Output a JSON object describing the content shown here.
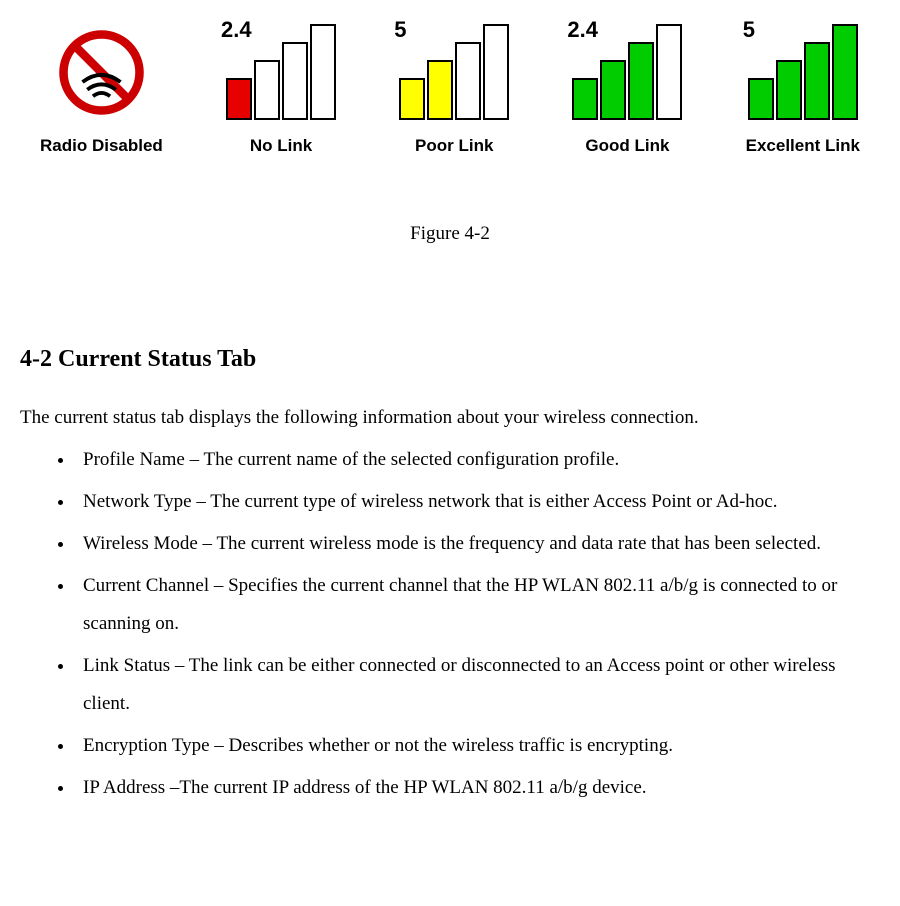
{
  "icons": {
    "disabled": {
      "caption": "Radio Disabled"
    },
    "nolink": {
      "band": "2.4",
      "caption": "No Link"
    },
    "poor": {
      "band": "5",
      "caption": "Poor Link"
    },
    "good": {
      "band": "2.4",
      "caption": "Good Link"
    },
    "excellent": {
      "band": "5",
      "caption": "Excellent Link"
    }
  },
  "figure_caption": "Figure 4-2",
  "section_heading": "4-2 Current Status Tab",
  "intro": "The current status tab displays the following information about your wireless connection.",
  "bullets": [
    "Profile Name – The current name of the selected configuration profile.",
    "Network Type – The current type of wireless network that is either Access Point or Ad-hoc.",
    "Wireless Mode – The current wireless mode is the frequency and data rate that has been selected.",
    "Current Channel – Specifies the current channel that the HP WLAN 802.11 a/b/g  is connected to or scanning on.",
    "Link Status – The link can be either connected or disconnected to an Access point or other wireless client.",
    "Encryption Type – Describes whether or not the wireless traffic is encrypting.",
    "IP Address –The current IP address of the HP WLAN 802.11 a/b/g  device."
  ]
}
